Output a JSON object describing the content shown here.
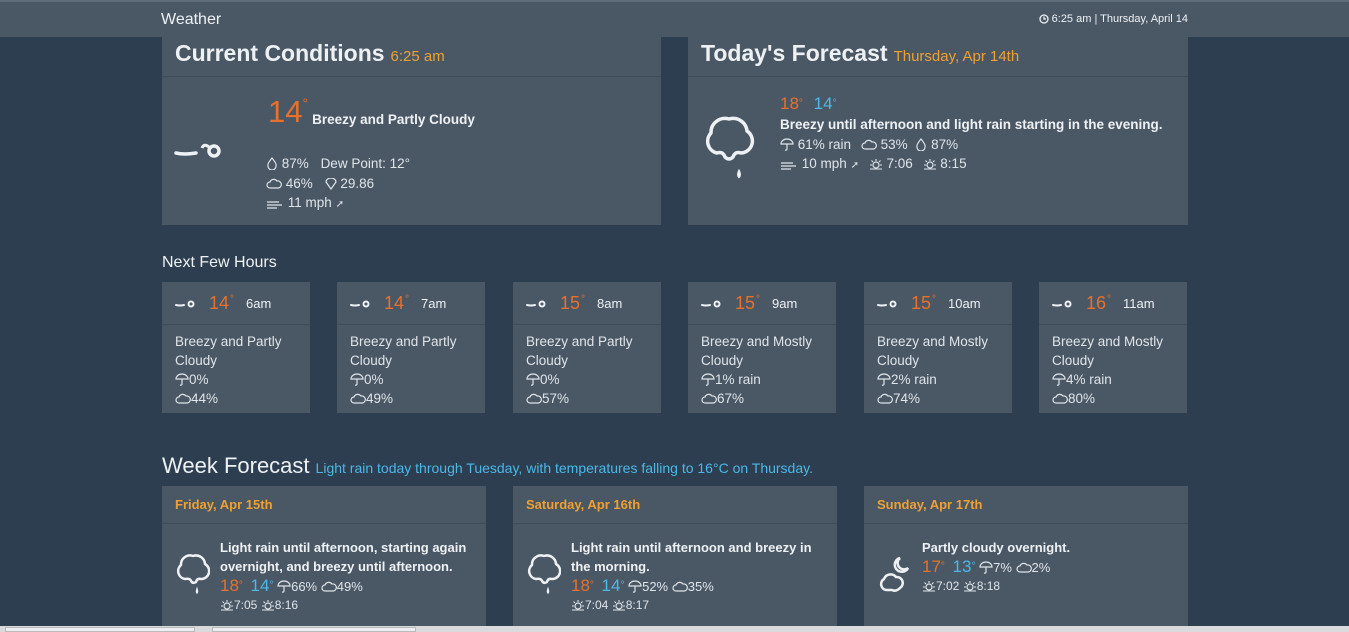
{
  "header": {
    "title": "Weather",
    "clock": "6:25 am | Thursday, April 14"
  },
  "current": {
    "title": "Current Conditions",
    "time": "6:25 am",
    "temp": "14",
    "summary": "Breezy and Partly Cloudy",
    "humidity": "87%",
    "dew_point": "Dew Point: 12°",
    "cloud": "46%",
    "pressure": "29.86",
    "wind": "11 mph"
  },
  "today": {
    "title": "Today's Forecast",
    "date": "Thursday, Apr 14th",
    "high": "18",
    "low": "14",
    "summary": "Breezy until afternoon and light rain starting in the evening.",
    "rain": "61% rain",
    "cloud": "53%",
    "humidity": "87%",
    "wind": "10 mph",
    "sunrise": "7:06",
    "sunset": "8:15"
  },
  "hours": {
    "title": "Next Few Hours",
    "items": [
      {
        "temp": "14",
        "hour": "6am",
        "summary": "Breezy and Partly Cloudy",
        "rain": "0%",
        "cloud": "44%"
      },
      {
        "temp": "14",
        "hour": "7am",
        "summary": "Breezy and Partly Cloudy",
        "rain": "0%",
        "cloud": "49%"
      },
      {
        "temp": "15",
        "hour": "8am",
        "summary": "Breezy and Partly Cloudy",
        "rain": "0%",
        "cloud": "57%"
      },
      {
        "temp": "15",
        "hour": "9am",
        "summary": "Breezy and Mostly Cloudy",
        "rain": "1% rain",
        "cloud": "67%"
      },
      {
        "temp": "15",
        "hour": "10am",
        "summary": "Breezy and Mostly Cloudy",
        "rain": "2% rain",
        "cloud": "74%"
      },
      {
        "temp": "16",
        "hour": "11am",
        "summary": "Breezy and Mostly Cloudy",
        "rain": "4% rain",
        "cloud": "80%"
      }
    ]
  },
  "week": {
    "title": "Week Forecast",
    "summary": "Light rain today through Tuesday, with temperatures falling to 16°C on Thursday.",
    "days": [
      {
        "date": "Friday, Apr 15th",
        "summary": "Light rain until afternoon, starting again overnight, and breezy until afternoon.",
        "high": "18",
        "low": "14",
        "rain": "66%",
        "cloud": "49%",
        "sunrise": "7:05",
        "sunset": "8:16",
        "icon": "rain-icon"
      },
      {
        "date": "Saturday, Apr 16th",
        "summary": "Light rain until afternoon and breezy in the morning.",
        "high": "18",
        "low": "14",
        "rain": "52%",
        "cloud": "35%",
        "sunrise": "7:04",
        "sunset": "8:17",
        "icon": "rain-icon"
      },
      {
        "date": "Sunday, Apr 17th",
        "summary": "Partly cloudy overnight.",
        "high": "17",
        "low": "13",
        "rain": "7%",
        "cloud": "2%",
        "sunrise": "7:02",
        "sunset": "8:18",
        "icon": "partly-cloudy-night-icon"
      }
    ]
  },
  "colors": {
    "background": "#2c3e50",
    "panel": "#4a5866",
    "high": "#e8702a",
    "low": "#4cb8e8",
    "accent": "#f0a030"
  }
}
